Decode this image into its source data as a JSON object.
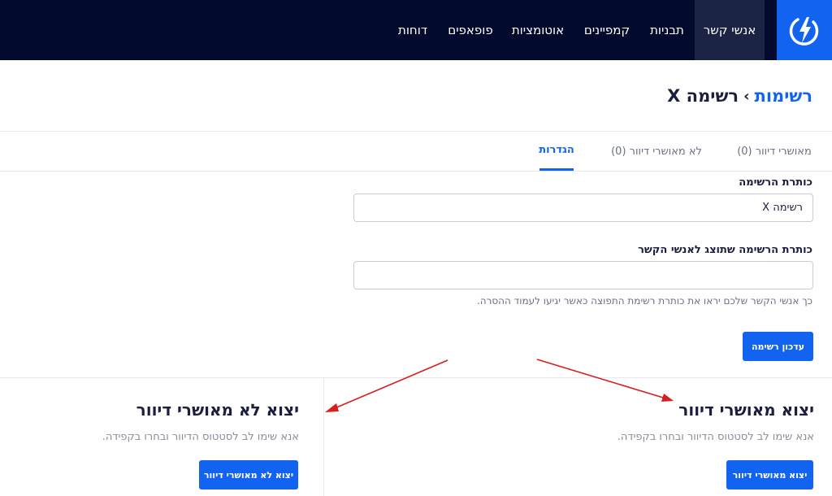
{
  "nav": {
    "items": [
      {
        "label": "אנשי קשר",
        "active": true
      },
      {
        "label": "תבניות",
        "active": false
      },
      {
        "label": "קמפיינים",
        "active": false
      },
      {
        "label": "אוטומציות",
        "active": false
      },
      {
        "label": "פופאפים",
        "active": false
      },
      {
        "label": "דוחות",
        "active": false
      }
    ],
    "logo_icon": "lightning-bolt-icon",
    "background": "#020a2e",
    "accent": "#1163f0"
  },
  "breadcrumb": {
    "parent": "רשימות",
    "separator": "›",
    "current": "רשימה X"
  },
  "tabs": [
    {
      "label": "מאושרי דיוור (0)",
      "active": false
    },
    {
      "label": "לא מאושרי דיוור (0)",
      "active": false
    },
    {
      "label": "הגדרות",
      "active": true
    }
  ],
  "form": {
    "list_title_label": "כותרת הרשימה",
    "list_title_value": "רשימה X",
    "display_title_label": "כותרת הרשימה שתוצג לאנשי הקשר",
    "display_title_value": "",
    "hint": "כך אנשי הקשר שלכם יראו את כותרת רשימת התפוצה כאשר יגיעו לעמוד ההסרה.",
    "update_button": "עדכון רשימה"
  },
  "export": {
    "approved": {
      "title": "יצוא מאושרי דיוור",
      "description": "אנא שימו לב לסטטוס הדיוור ובחרו בקפידה.",
      "button": "יצוא מאושרי דיוור"
    },
    "unapproved": {
      "title": "יצוא לא מאושרי דיוור",
      "description": "אנא שימו לב לסטטוס הדיוור ובחרו בקפידה.",
      "button": "יצוא לא מאושרי דיוור"
    }
  },
  "annotation_color": "#d42020"
}
